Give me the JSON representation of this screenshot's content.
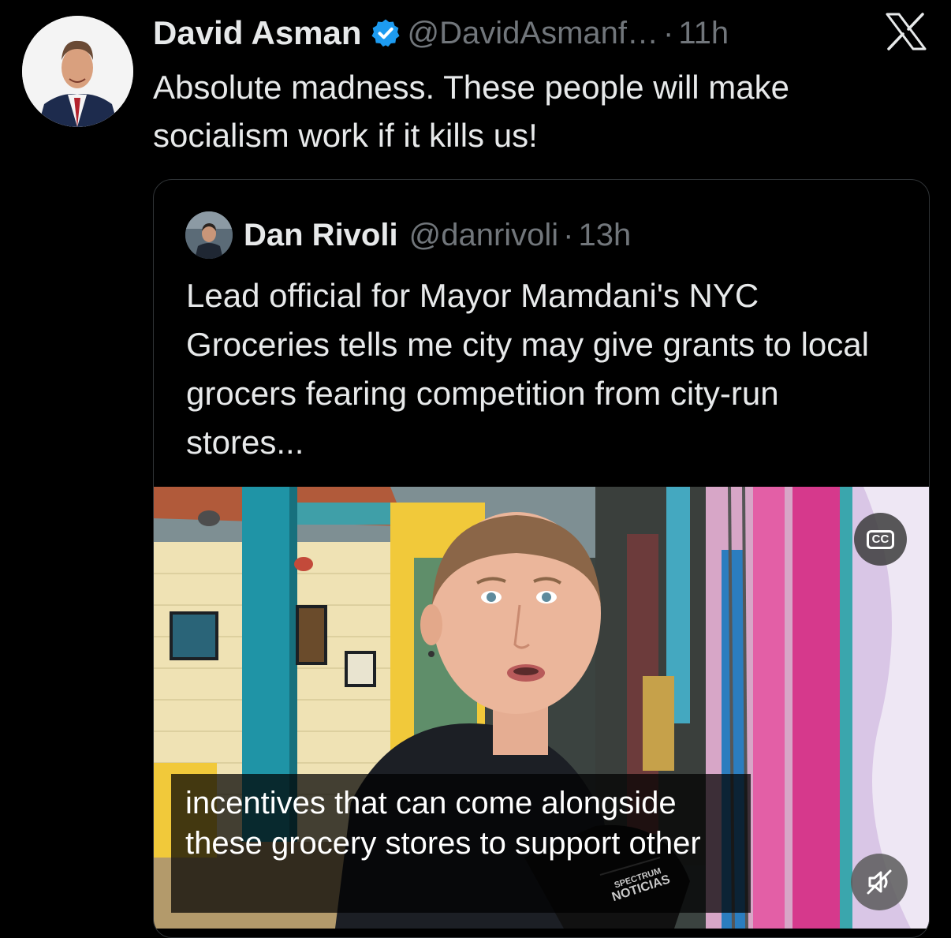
{
  "tweet": {
    "author_name": "David Asman",
    "author_handle": "@DavidAsmanf…",
    "separator": "·",
    "time": "11h",
    "text": "Absolute madness. These people will make socialism work if it kills us!"
  },
  "quoted": {
    "author_name": "Dan Rivoli",
    "author_handle": "@danrivoli",
    "separator": "·",
    "time": "13h",
    "text": "Lead official for Mayor Mamdani's NYC Groceries tells me city may give grants to local grocers fearing competition from city-run stores..."
  },
  "video": {
    "cc_label": "CC",
    "caption": "incentives that can come alongside these grocery stores to support other",
    "mic_flag_line1": "SPECTRUM",
    "mic_flag_line2": "NOTICIAS"
  },
  "icons": {
    "verified": "verified-badge-icon",
    "brand": "x-logo-icon",
    "mute": "muted-speaker-icon"
  },
  "colors": {
    "background": "#000000",
    "text": "#e7e9ea",
    "secondary": "#71767b",
    "verified": "#1d9bf0"
  }
}
